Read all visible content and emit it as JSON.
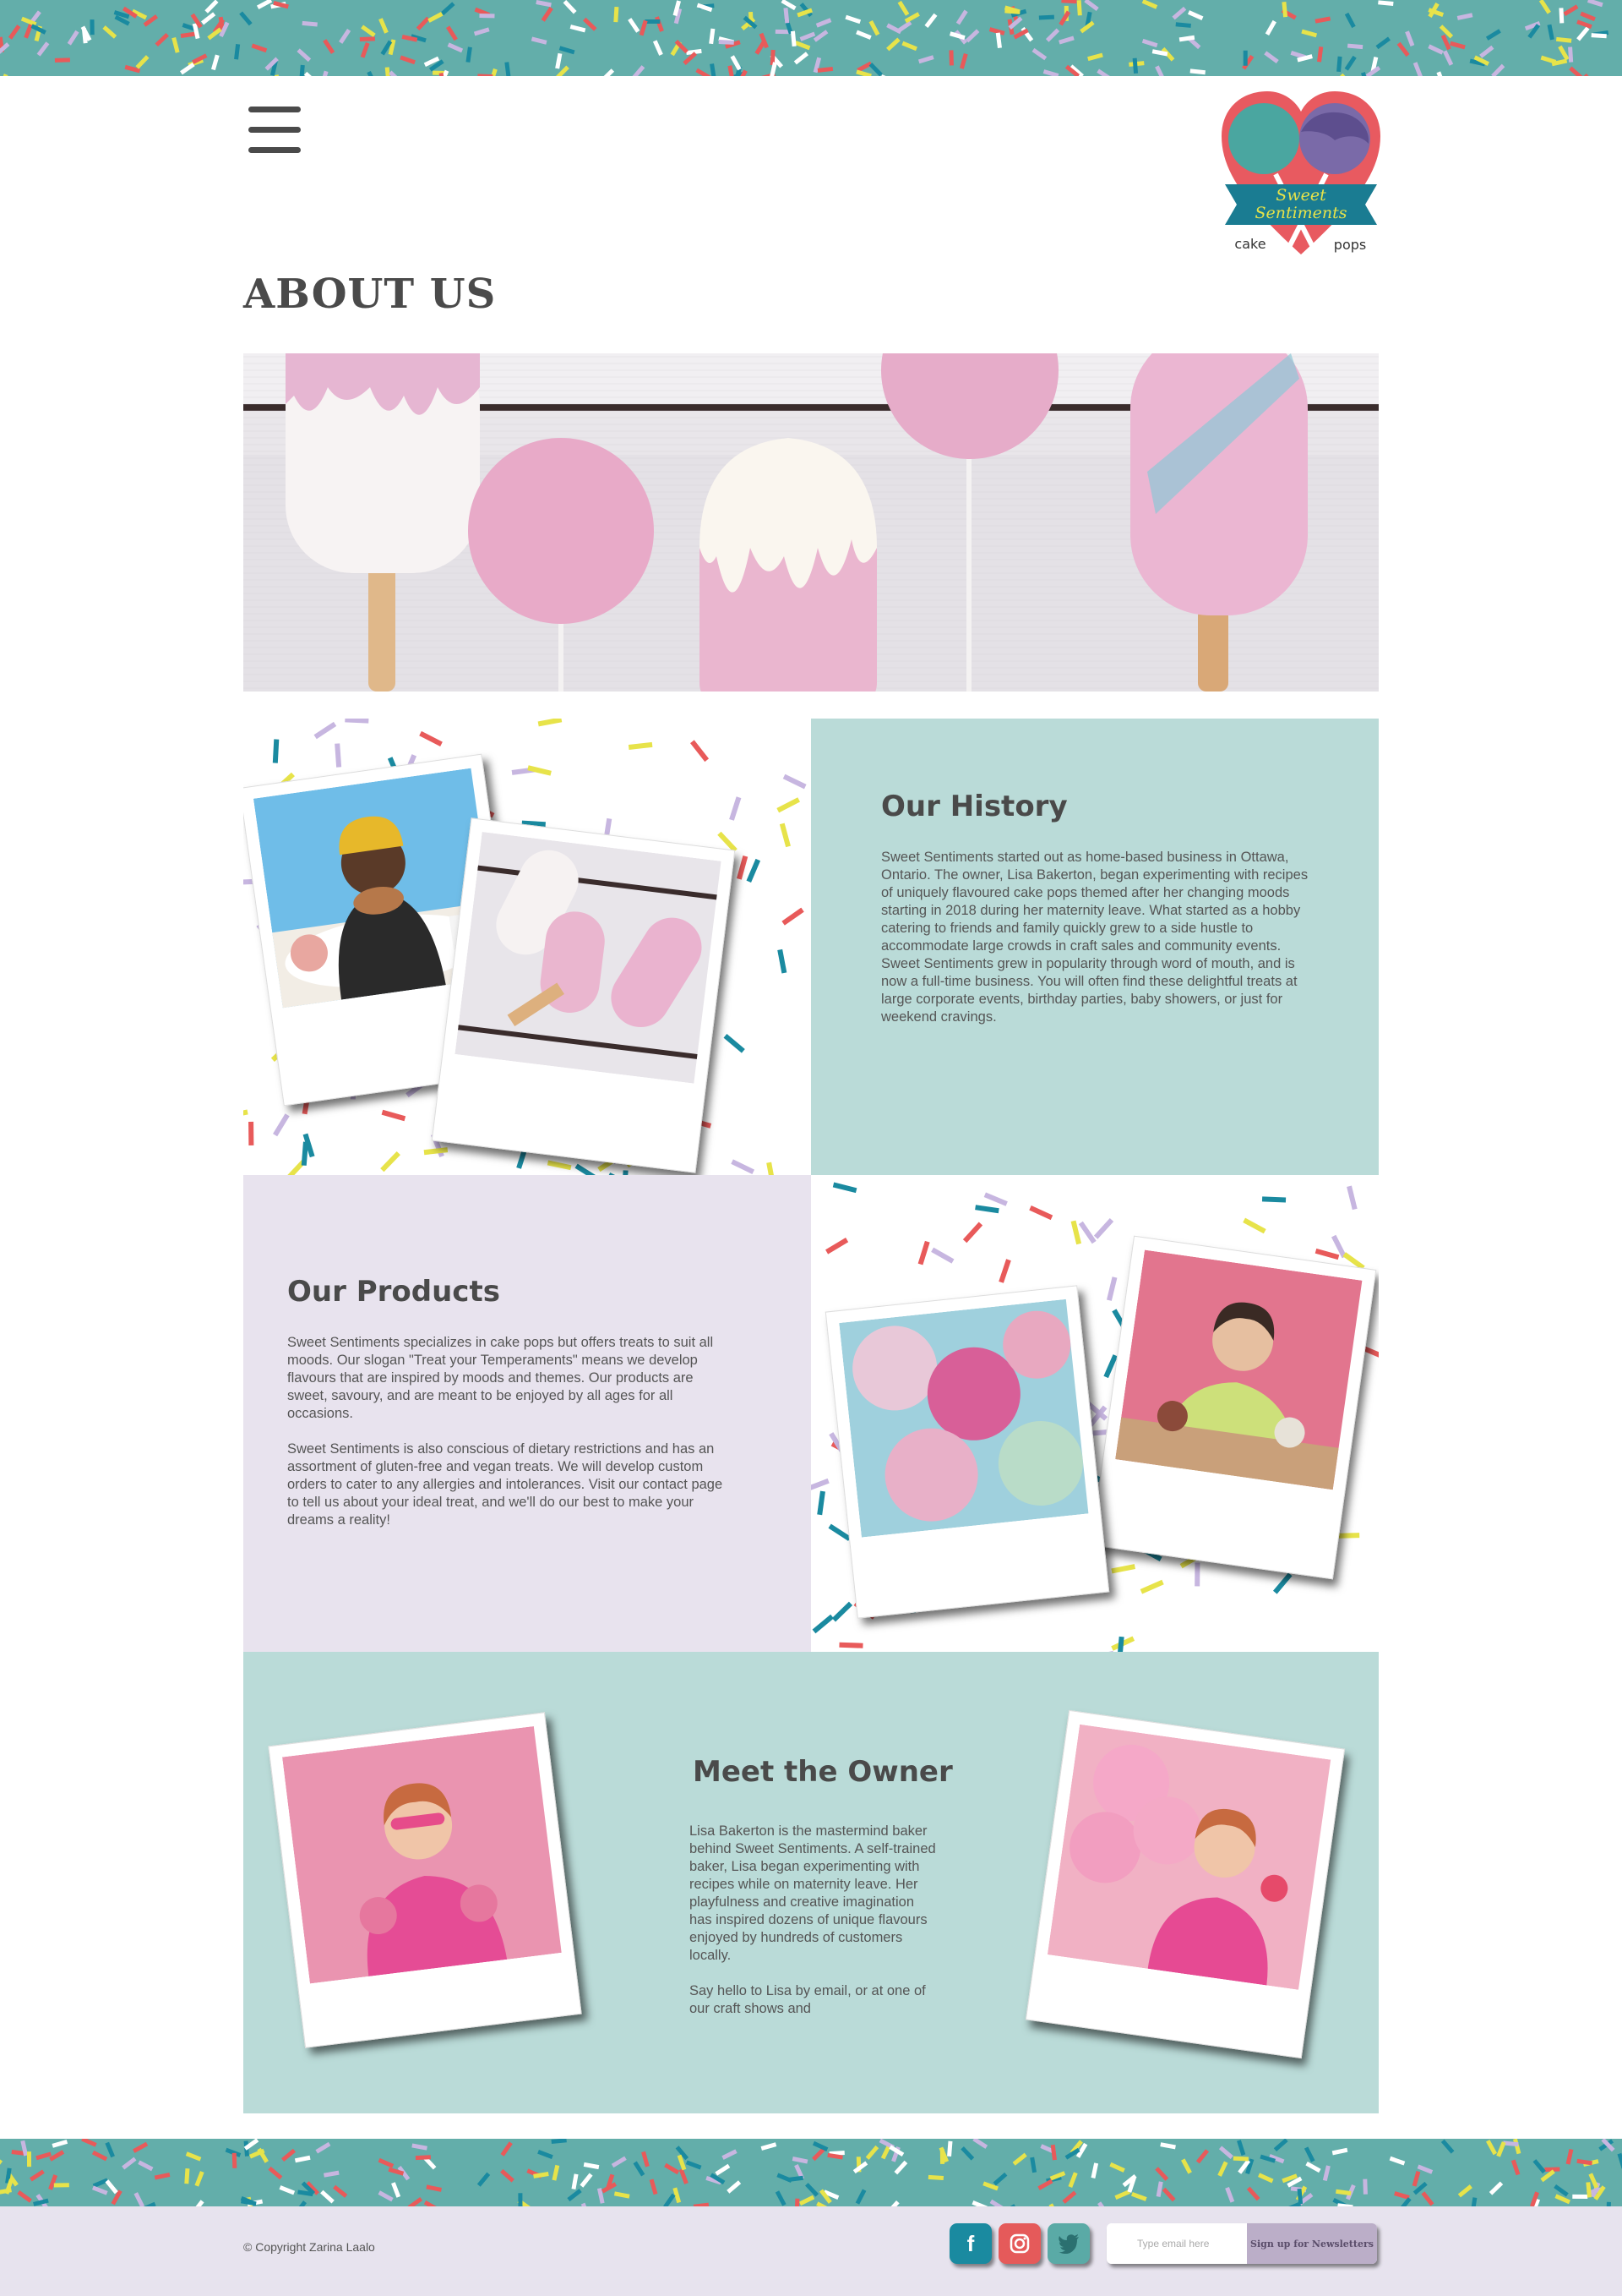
{
  "header": {
    "menu_icon": "hamburger-menu-icon",
    "logo": {
      "line1": "Sweet",
      "line2": "Sentiments",
      "left": "cake",
      "right": "pops"
    }
  },
  "page": {
    "title": "ABOUT US"
  },
  "history": {
    "heading": "Our History",
    "body": "Sweet Sentiments started out as home-based business in Ottawa, Ontario. The owner, Lisa Bakerton, began experimenting with recipes of uniquely flavoured cake pops themed after her changing moods starting in 2018 during her maternity leave. What started as a hobby catering to friends and family quickly grew to a side hustle to accommodate large crowds in craft sales and community events. Sweet Sentiments grew in popularity through word of mouth, and is now a full-time business. You will often find these delightful treats at large corporate events, birthday parties, baby showers, or just for weekend cravings."
  },
  "products": {
    "heading": "Our Products",
    "body1": "Sweet Sentiments specializes in cake pops but offers treats to suit all moods. Our slogan \"Treat your Temperaments\" means we develop flavours that are inspired by moods and themes. Our products are sweet, savoury, and are meant to be enjoyed by all ages for all occasions.",
    "body2": "Sweet Sentiments is also conscious of dietary restrictions and has an assortment of gluten-free and vegan treats. We will develop custom orders to cater to any allergies and intolerances. Visit our contact page to tell us about your ideal treat, and we'll do our best to make your dreams a reality!"
  },
  "owner": {
    "heading": "Meet the Owner",
    "body1": "Lisa Bakerton is the mastermind baker behind Sweet Sentiments. A self-trained baker, Lisa began experimenting with recipes while on maternity leave. Her playfulness and creative imagination has inspired dozens of unique flavours enjoyed by hundreds of customers locally.",
    "body2": "Say hello to Lisa by email, or at one of our craft shows and"
  },
  "footer": {
    "copyright": "© Copyright Zarina Laalo",
    "social": [
      {
        "icon": "facebook-icon",
        "glyph": "f",
        "color": "#1a8aa0"
      },
      {
        "icon": "instagram-icon",
        "glyph": "◎",
        "color": "#e55a5a"
      },
      {
        "icon": "twitter-icon",
        "glyph": "🐦",
        "color": "#5aaaa6"
      }
    ],
    "email_placeholder": "Type email here",
    "signup_label": "Sign up for Newsletters"
  },
  "colors": {
    "teal_band": "#63aeaa",
    "teal_block": "#badbd8",
    "lilac_block": "#e8e3ee",
    "pink_logo": "#e85a60",
    "text_dark": "#4a4a4a"
  }
}
